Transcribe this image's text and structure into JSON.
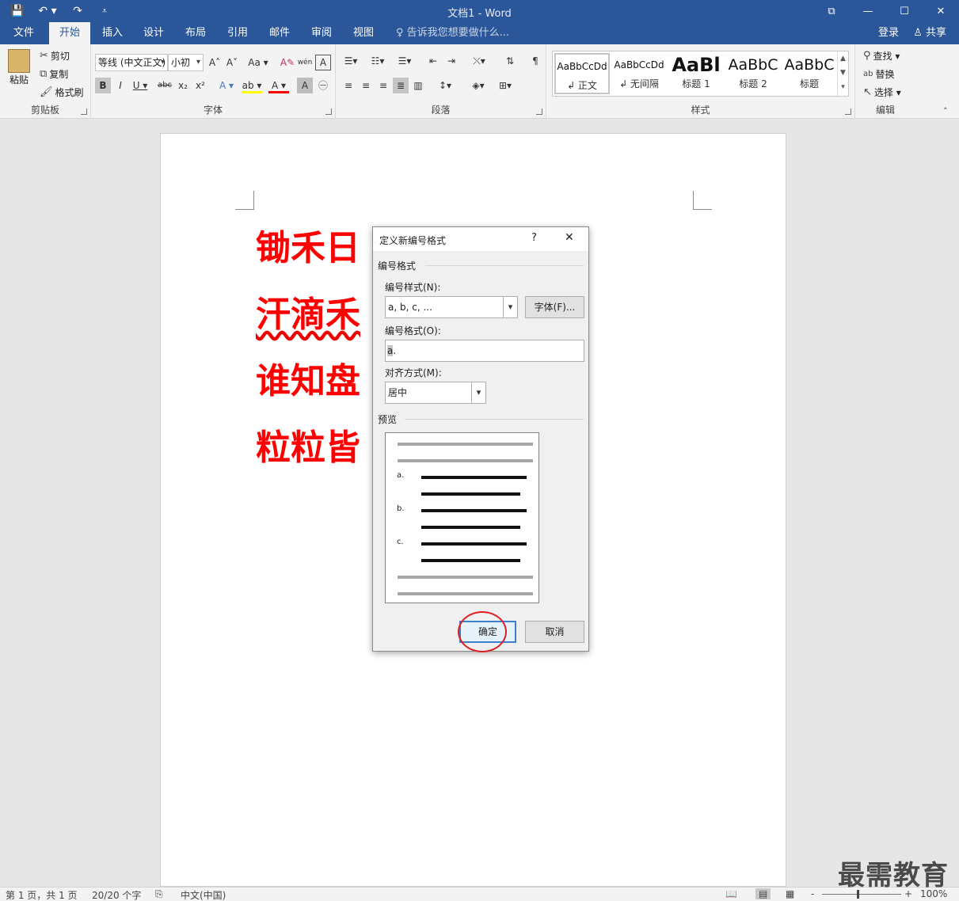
{
  "titlebar": {
    "title": "文档1 - Word",
    "qat": {
      "save_icon": "💾",
      "undo_icon": "↶ ▾",
      "redo_icon": "↷",
      "customize_icon": "⩡"
    },
    "controls": {
      "ribbon_display": "⧉",
      "minimize": "—",
      "maximize": "☐",
      "close": "✕"
    }
  },
  "tabs": [
    {
      "label": "文件"
    },
    {
      "label": "开始"
    },
    {
      "label": "插入"
    },
    {
      "label": "设计"
    },
    {
      "label": "布局"
    },
    {
      "label": "引用"
    },
    {
      "label": "邮件"
    },
    {
      "label": "审阅"
    },
    {
      "label": "视图"
    }
  ],
  "tell_me": "♀ 告诉我您想要做什么...",
  "account": {
    "login": "登录",
    "share": "♙ 共享"
  },
  "ribbon": {
    "clipboard": {
      "label": "剪贴板",
      "paste": "粘贴",
      "cut": "剪切",
      "copy": "复制",
      "format_painter": "格式刷"
    },
    "font": {
      "label": "字体",
      "font_name": "等线 (中文正文)",
      "font_size": "小初",
      "grow": "A˄",
      "shrink": "A˅",
      "case": "Aa ▾",
      "clear": "A✎",
      "phonetic": "wén",
      "border": "A",
      "bold": "B",
      "italic": "I",
      "underline": "U ▾",
      "strike": "abc",
      "sub": "x₂",
      "sup": "x²",
      "effects": "A ▾",
      "highlight": "ab ▾",
      "color": "A ▾",
      "shade": "A",
      "enclose": "㊀"
    },
    "paragraph": {
      "label": "段落"
    },
    "styles": {
      "label": "样式",
      "items": [
        {
          "sample": "AaBbCcDd",
          "name": "↲ 正文"
        },
        {
          "sample": "AaBbCcDd",
          "name": "↲ 无间隔"
        },
        {
          "sample": "AaBl",
          "name": "标题 1"
        },
        {
          "sample": "AaBbC",
          "name": "标题 2"
        },
        {
          "sample": "AaBbC",
          "name": "标题"
        }
      ]
    },
    "editing": {
      "label": "编辑",
      "find": "查找 ▾",
      "replace": "替换",
      "select": "选择 ▾"
    }
  },
  "document": {
    "lines": [
      "锄禾日",
      "汗滴禾",
      "谁知盘",
      "粒粒皆"
    ],
    "text_color": "#ff0000"
  },
  "dialog": {
    "title": "定义新编号格式",
    "help": "?",
    "close": "✕",
    "section_format": "编号格式",
    "style_label": "编号样式(N):",
    "style_value": "a, b, c, ...",
    "font_button": "字体(F)...",
    "format_label": "编号格式(O):",
    "format_value": "a",
    "format_suffix": ".",
    "align_label": "对齐方式(M):",
    "align_value": "居中",
    "section_preview": "预览",
    "preview_numbers": [
      "a.",
      "b.",
      "c."
    ],
    "ok": "确定",
    "cancel": "取消"
  },
  "status": {
    "page": "第 1 页，共 1 页",
    "words": "20/20 个字",
    "lang": "中文(中国)",
    "zoom": "100%",
    "zoom_out": "-",
    "zoom_in": "+"
  },
  "watermark": "最需教育"
}
